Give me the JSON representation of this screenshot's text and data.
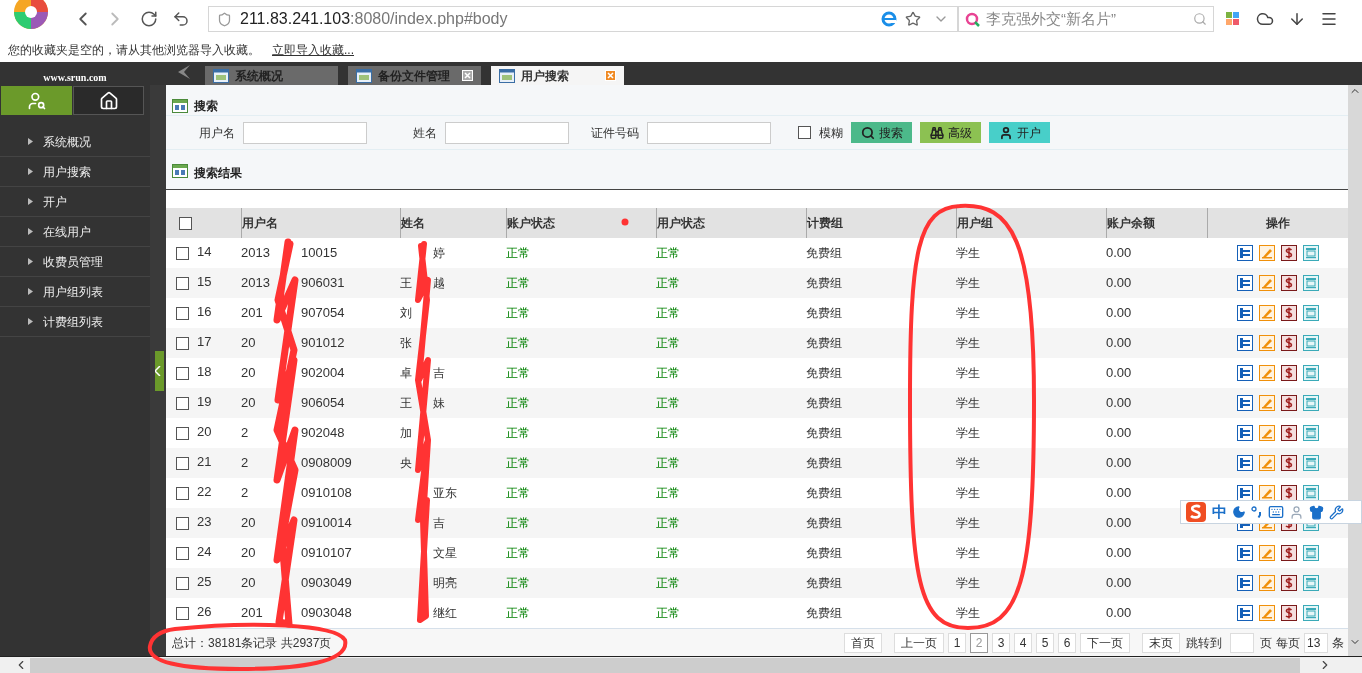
{
  "browser": {
    "url_host": "211.83.241.103",
    "url_rest": ":8080/index.php#body",
    "search_placeholder": "李克强外交“新名片”",
    "bookmark_message": "您的收藏夹是空的，请从其他浏览器导入收藏。",
    "bookmark_link": "立即导入收藏..."
  },
  "app": {
    "logo_url": "www.srun.com",
    "tabs": [
      {
        "label": "系统概况",
        "selected": false,
        "closable": false
      },
      {
        "label": "备份文件管理",
        "selected": false,
        "closable": true
      },
      {
        "label": "用户搜索",
        "selected": true,
        "closable": true
      }
    ]
  },
  "sidebar": {
    "items": [
      "系统概况",
      "用户搜索",
      "开户",
      "在线用户",
      "收费员管理",
      "用户组列表",
      "计费组列表"
    ]
  },
  "search": {
    "title": "搜索",
    "fields": [
      {
        "label": "用户名"
      },
      {
        "label": "姓名"
      },
      {
        "label": "证件号码"
      }
    ],
    "fuzzy": {
      "label": "模糊",
      "checked": false
    },
    "buttons": [
      {
        "label": "搜索",
        "kind": "search"
      },
      {
        "label": "高级",
        "kind": "advanced"
      },
      {
        "label": "开户",
        "kind": "open"
      }
    ]
  },
  "results": {
    "title": "搜索结果",
    "all_checked": false,
    "columns": [
      "用户名",
      "姓名",
      "账户状态",
      "用户状态",
      "计费组",
      "用户组",
      "账户余额",
      "操作"
    ],
    "rows": [
      {
        "index": "14",
        "username_start": "2013",
        "username_end": "10015",
        "name_start": "",
        "name_end": "婷",
        "account_status": "正常",
        "user_status": "正常",
        "billing_group": "免费组",
        "user_group": "学生",
        "balance": "0.00",
        "checked": false
      },
      {
        "index": "15",
        "username_start": "2013",
        "username_end": "906031",
        "name_start": "王",
        "name_end": "越",
        "account_status": "正常",
        "user_status": "正常",
        "billing_group": "免费组",
        "user_group": "学生",
        "balance": "0.00",
        "checked": false
      },
      {
        "index": "16",
        "username_start": "201",
        "username_end": "907054",
        "name_start": "刘",
        "name_end": "",
        "account_status": "正常",
        "user_status": "正常",
        "billing_group": "免费组",
        "user_group": "学生",
        "balance": "0.00",
        "checked": false
      },
      {
        "index": "17",
        "username_start": "20",
        "username_end": "901012",
        "name_start": "张",
        "name_end": "",
        "account_status": "正常",
        "user_status": "正常",
        "billing_group": "免费组",
        "user_group": "学生",
        "balance": "0.00",
        "checked": false
      },
      {
        "index": "18",
        "username_start": "20",
        "username_end": "902004",
        "name_start": "卓",
        "name_end": "吉",
        "account_status": "正常",
        "user_status": "正常",
        "billing_group": "免费组",
        "user_group": "学生",
        "balance": "0.00",
        "checked": false
      },
      {
        "index": "19",
        "username_start": "20",
        "username_end": "906054",
        "name_start": "王",
        "name_end": "妹",
        "account_status": "正常",
        "user_status": "正常",
        "billing_group": "免费组",
        "user_group": "学生",
        "balance": "0.00",
        "checked": false
      },
      {
        "index": "20",
        "username_start": "2",
        "username_end": "902048",
        "name_start": "加",
        "name_end": "",
        "account_status": "正常",
        "user_status": "正常",
        "billing_group": "免费组",
        "user_group": "学生",
        "balance": "0.00",
        "checked": false
      },
      {
        "index": "21",
        "username_start": "2",
        "username_end": "0908009",
        "name_start": "央",
        "name_end": "",
        "account_status": "正常",
        "user_status": "正常",
        "billing_group": "免费组",
        "user_group": "学生",
        "balance": "0.00",
        "checked": false
      },
      {
        "index": "22",
        "username_start": "2",
        "username_end": "0910108",
        "name_start": "",
        "name_end": "亚东",
        "account_status": "正常",
        "user_status": "正常",
        "billing_group": "免费组",
        "user_group": "学生",
        "balance": "0.00",
        "checked": false
      },
      {
        "index": "23",
        "username_start": "20",
        "username_end": "0910014",
        "name_start": "",
        "name_end": "吉",
        "account_status": "正常",
        "user_status": "正常",
        "billing_group": "免费组",
        "user_group": "学生",
        "balance": "0.00",
        "checked": false
      },
      {
        "index": "24",
        "username_start": "20",
        "username_end": "0910107",
        "name_start": "",
        "name_end": "文星",
        "account_status": "正常",
        "user_status": "正常",
        "billing_group": "免费组",
        "user_group": "学生",
        "balance": "0.00",
        "checked": false
      },
      {
        "index": "25",
        "username_start": "20",
        "username_end": "0903049",
        "name_start": "",
        "name_end": "明亮",
        "account_status": "正常",
        "user_status": "正常",
        "billing_group": "免费组",
        "user_group": "学生",
        "balance": "0.00",
        "checked": false
      },
      {
        "index": "26",
        "username_start": "201",
        "username_end": "0903048",
        "name_start": "",
        "name_end": "继红",
        "account_status": "正常",
        "user_status": "正常",
        "billing_group": "免费组",
        "user_group": "学生",
        "balance": "0.00",
        "checked": false
      }
    ],
    "total": "总计：38181条记录 共2937页"
  },
  "pagination": {
    "first": "首页",
    "prev": "上一页",
    "pages": [
      {
        "label": "1",
        "selected": false
      },
      {
        "label": "2",
        "selected": true
      },
      {
        "label": "3",
        "selected": false
      },
      {
        "label": "4",
        "selected": false
      },
      {
        "label": "5",
        "selected": false
      },
      {
        "label": "6",
        "selected": false
      }
    ],
    "next": "下一页",
    "last": "末页",
    "jump_label": "跳转到",
    "page_unit": "页",
    "per_page_label": "每页",
    "per_page": "13",
    "per_page_unit": "条"
  },
  "ime": {
    "mode": "中"
  }
}
